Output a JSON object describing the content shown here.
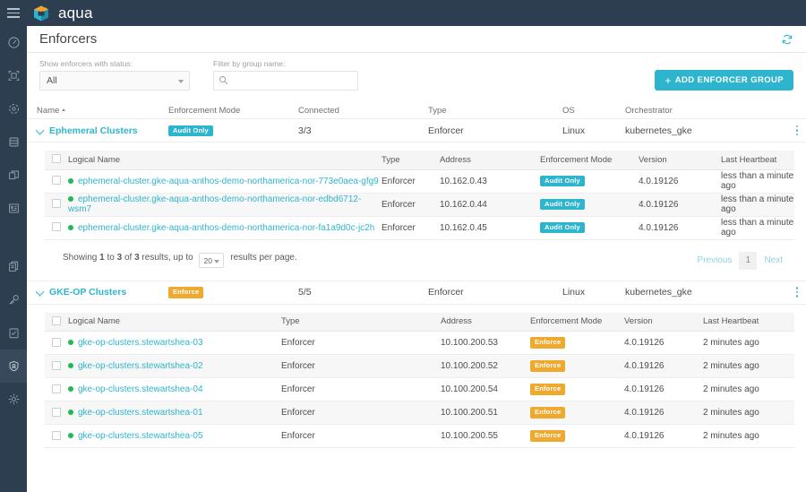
{
  "topbar": {
    "menu_icon": "hamburger-icon",
    "brand": "aqua",
    "logo_icon": "aqua-logo-icon"
  },
  "sidebar": {
    "items": [
      {
        "icon": "dashboard-gauge-icon",
        "active": false
      },
      {
        "icon": "scan-frame-icon",
        "active": false
      },
      {
        "icon": "container-nodes-icon",
        "active": false
      },
      {
        "icon": "database-icon",
        "active": false
      },
      {
        "icon": "copy-layers-icon",
        "active": false
      },
      {
        "icon": "factory-icon",
        "active": false
      },
      {
        "icon": "policies-documents-icon",
        "active": false
      },
      {
        "icon": "key-icon",
        "active": false
      },
      {
        "icon": "clipboard-check-icon",
        "active": false
      },
      {
        "icon": "shield-enforcer-icon",
        "active": true
      },
      {
        "icon": "gear-settings-icon",
        "active": false
      }
    ]
  },
  "page": {
    "title": "Enforcers",
    "refresh_icon": "refresh-icon"
  },
  "filters": {
    "status_label": "Show enforcers with status:",
    "status_value": "All",
    "group_label": "Filter by group name:",
    "group_placeholder": "",
    "search_icon": "search-icon",
    "add_button": "ADD ENFORCER GROUP",
    "add_button_plus": "+"
  },
  "outer_table": {
    "columns": [
      "Name",
      "Enforcement Mode",
      "Connected",
      "Type",
      "OS",
      "Orchestrator"
    ],
    "sorted_column": "Name",
    "groups": [
      {
        "name": "Ephemeral Clusters",
        "mode": "Audit Only",
        "mode_style": "audit",
        "connected": "3/3",
        "type": "Enforcer",
        "os": "Linux",
        "orchestrator": "kubernetes_gke",
        "kebab_icon": "kebab-menu-icon",
        "inner": {
          "columns": [
            "Logical Name",
            "Type",
            "Address",
            "Enforcement Mode",
            "Version",
            "Last Heartbeat"
          ],
          "rows": [
            {
              "logical_name": "ephemeral-cluster.gke-aqua-anthos-demo-northamerica-nor-773e0aea-gfg9",
              "type": "Enforcer",
              "address": "10.162.0.43",
              "mode": "Audit Only",
              "mode_style": "audit",
              "version": "4.0.19126",
              "heartbeat": "less than a minute ago"
            },
            {
              "logical_name": "ephemeral-cluster.gke-aqua-anthos-demo-northamerica-nor-edbd6712-wsm7",
              "type": "Enforcer",
              "address": "10.162.0.44",
              "mode": "Audit Only",
              "mode_style": "audit",
              "version": "4.0.19126",
              "heartbeat": "less than a minute ago"
            },
            {
              "logical_name": "ephemeral-cluster.gke-aqua-anthos-demo-northamerica-nor-fa1a9d0c-jc2h",
              "type": "Enforcer",
              "address": "10.162.0.45",
              "mode": "Audit Only",
              "mode_style": "audit",
              "version": "4.0.19126",
              "heartbeat": "less than a minute ago"
            }
          ],
          "pager": {
            "prefix": "Showing",
            "from": "1",
            "mid": "to",
            "to": "3",
            "of": "of",
            "total": "3",
            "results_text": "results, up to",
            "per_page": "20",
            "suffix": "results per page.",
            "previous": "Previous",
            "current": "1",
            "next": "Next"
          }
        }
      },
      {
        "name": "GKE-OP Clusters",
        "mode": "Enforce",
        "mode_style": "enforce",
        "connected": "5/5",
        "type": "Enforcer",
        "os": "Linux",
        "orchestrator": "kubernetes_gke",
        "kebab_icon": "kebab-menu-icon",
        "inner": {
          "columns": [
            "Logical Name",
            "Type",
            "Address",
            "Enforcement Mode",
            "Version",
            "Last Heartbeat"
          ],
          "rows": [
            {
              "logical_name": "gke-op-clusters.stewartshea-03",
              "type": "Enforcer",
              "address": "10.100.200.53",
              "mode": "Enforce",
              "mode_style": "enforce",
              "version": "4.0.19126",
              "heartbeat": "2 minutes ago"
            },
            {
              "logical_name": "gke-op-clusters.stewartshea-02",
              "type": "Enforcer",
              "address": "10.100.200.52",
              "mode": "Enforce",
              "mode_style": "enforce",
              "version": "4.0.19126",
              "heartbeat": "2 minutes ago"
            },
            {
              "logical_name": "gke-op-clusters.stewartshea-04",
              "type": "Enforcer",
              "address": "10.100.200.54",
              "mode": "Enforce",
              "mode_style": "enforce",
              "version": "4.0.19126",
              "heartbeat": "2 minutes ago"
            },
            {
              "logical_name": "gke-op-clusters.stewartshea-01",
              "type": "Enforcer",
              "address": "10.100.200.51",
              "mode": "Enforce",
              "mode_style": "enforce",
              "version": "4.0.19126",
              "heartbeat": "2 minutes ago"
            },
            {
              "logical_name": "gke-op-clusters.stewartshea-05",
              "type": "Enforcer",
              "address": "10.100.200.55",
              "mode": "Enforce",
              "mode_style": "enforce",
              "version": "4.0.19126",
              "heartbeat": "2 minutes ago"
            }
          ]
        }
      }
    ]
  },
  "colors": {
    "brand_dark": "#2c3e50",
    "accent_teal": "#2eb5ce",
    "enforce_orange": "#efa92e",
    "status_green": "#1db954"
  }
}
